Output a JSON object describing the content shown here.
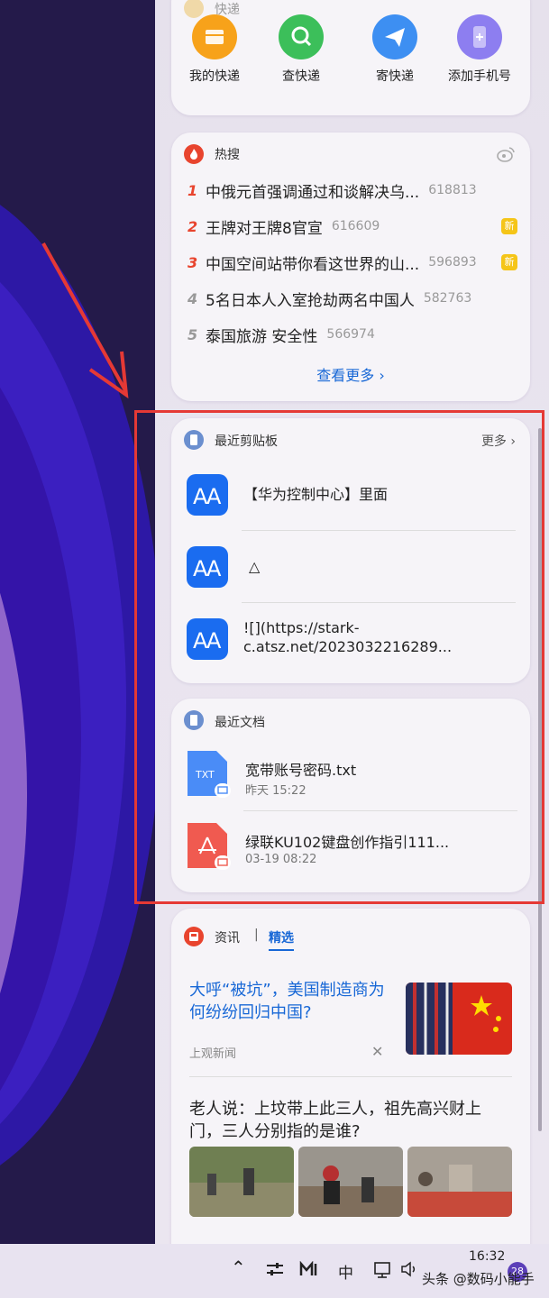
{
  "express": {
    "title": "快递",
    "actions": [
      {
        "label": "我的快递",
        "color": "#f7a21a"
      },
      {
        "label": "查快递",
        "color": "#3cbf5a"
      },
      {
        "label": "寄快递",
        "color": "#3d8ff2"
      },
      {
        "label": "添加手机号",
        "color": "#8d7ef0"
      }
    ]
  },
  "hot": {
    "title": "热搜",
    "items": [
      {
        "rank": "1",
        "text": "中俄元首强调通过和谈解决乌...",
        "heat": "618813",
        "is_new": false
      },
      {
        "rank": "2",
        "text": "王牌对王牌8官宣",
        "heat": "616609",
        "is_new": true
      },
      {
        "rank": "3",
        "text": "中国空间站带你看这世界的山...",
        "heat": "596893",
        "is_new": true
      },
      {
        "rank": "4",
        "text": "5名日本人入室抢劫两名中国人",
        "heat": "582763",
        "is_new": false
      },
      {
        "rank": "5",
        "text": "泰国旅游 安全性",
        "heat": "566974",
        "is_new": false
      }
    ],
    "new_badge": "新",
    "more_label": "查看更多",
    "rank_colors": {
      "top": "#e8442e",
      "rest": "#999999"
    }
  },
  "clipboard": {
    "title": "最近剪贴板",
    "more_label": "更多",
    "items": [
      {
        "line1": "【华为控制中心】里面",
        "line2": ""
      },
      {
        "line1": "△",
        "line2": ""
      },
      {
        "line1": "![](https://stark-",
        "line2": "c.atsz.net/2023032216289..."
      }
    ]
  },
  "documents": {
    "title": "最近文档",
    "items": [
      {
        "name": "宽带账号密码.txt",
        "time": "昨天 15:22",
        "ext": "TXT",
        "color": "#4a8cf7"
      },
      {
        "name": "绿联KU102键盘创作指引111...",
        "time": "03-19 08:22",
        "ext": "PDF",
        "color": "#f05a50"
      }
    ]
  },
  "news": {
    "title": "资讯",
    "separator": "|",
    "tab": "精选",
    "article1": {
      "headline": "大呼“被坑”，美国制造商为何纷纷回归中国?",
      "source": "上观新闻"
    },
    "article2": {
      "headline": "老人说：上坟带上此三人，祖先高兴财上门，三人分别指的是谁?"
    },
    "link_color": "#1767d6"
  },
  "taskbar": {
    "ime": "中",
    "time": "16:32",
    "badge": "28",
    "watermark": "头条 @数码小能手"
  }
}
